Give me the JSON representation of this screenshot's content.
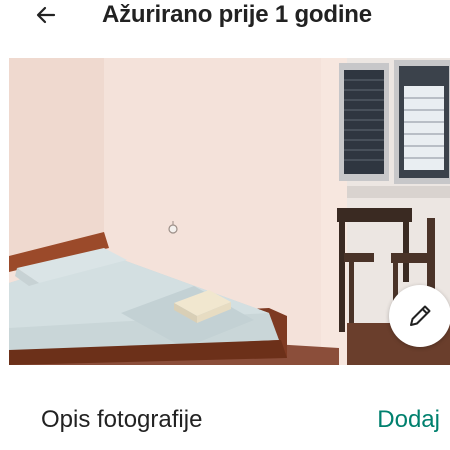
{
  "header": {
    "back_icon": "arrow-left-icon",
    "title": "Ažurirano prije 1 godine"
  },
  "photo": {
    "edit_icon": "pencil-icon"
  },
  "description": {
    "label": "Opis fotografije",
    "action_label": "Dodaj",
    "action_color": "#00806e"
  }
}
